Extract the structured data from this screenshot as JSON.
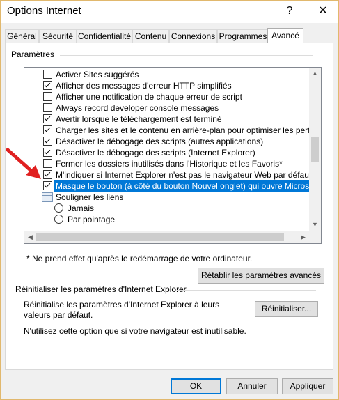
{
  "window": {
    "title": "Options Internet",
    "help_glyph": "?",
    "close_glyph": "✕"
  },
  "tabs": [
    {
      "label": "Général",
      "active": false
    },
    {
      "label": "Sécurité",
      "active": false
    },
    {
      "label": "Confidentialité",
      "active": false
    },
    {
      "label": "Contenu",
      "active": false
    },
    {
      "label": "Connexions",
      "active": false
    },
    {
      "label": "Programmes",
      "active": false
    },
    {
      "label": "Avancé",
      "active": true
    }
  ],
  "settings": {
    "group_label": "Paramètres",
    "items": [
      {
        "kind": "checkbox",
        "checked": false,
        "label": "Activer Sites suggérés"
      },
      {
        "kind": "checkbox",
        "checked": true,
        "label": "Afficher des messages d'erreur HTTP simplifiés"
      },
      {
        "kind": "checkbox",
        "checked": false,
        "label": "Afficher une notification de chaque erreur de script"
      },
      {
        "kind": "checkbox",
        "checked": false,
        "label": "Always record developer console messages"
      },
      {
        "kind": "checkbox",
        "checked": true,
        "label": "Avertir lorsque le téléchargement est terminé"
      },
      {
        "kind": "checkbox",
        "checked": true,
        "label": "Charger les sites et le contenu en arrière-plan pour optimiser les performan"
      },
      {
        "kind": "checkbox",
        "checked": true,
        "label": "Désactiver le débogage des scripts (autres applications)"
      },
      {
        "kind": "checkbox",
        "checked": true,
        "label": "Désactiver le débogage des scripts (Internet Explorer)"
      },
      {
        "kind": "checkbox",
        "checked": false,
        "label": "Fermer les dossiers inutilisés dans l'Historique et les Favoris*"
      },
      {
        "kind": "checkbox",
        "checked": true,
        "label": "M'indiquer si Internet Explorer n'est pas le navigateur Web par défaut"
      },
      {
        "kind": "checkbox",
        "checked": true,
        "selected": true,
        "label": "Masque le bouton (à côté du bouton Nouvel onglet) qui ouvre Microsoft Edg"
      },
      {
        "kind": "group",
        "label": "Souligner les liens"
      },
      {
        "kind": "radio",
        "label": "Jamais"
      },
      {
        "kind": "radio",
        "label": "Par pointage"
      }
    ],
    "note": "* Ne prend effet qu'après le redémarrage de votre ordinateur.",
    "restore_button": "Rétablir les paramètres avancés"
  },
  "reset": {
    "section_label": "Réinitialiser les paramètres d'Internet Explorer",
    "description": "Réinitialise les paramètres d'Internet Explorer à leurs valeurs par défaut.",
    "button": "Réinitialiser...",
    "hint": "N'utilisez cette option que si votre navigateur est inutilisable."
  },
  "footer": {
    "ok": "OK",
    "cancel": "Annuler",
    "apply": "Appliquer"
  },
  "colors": {
    "selection": "#0078d7",
    "arrow": "#e02020"
  }
}
